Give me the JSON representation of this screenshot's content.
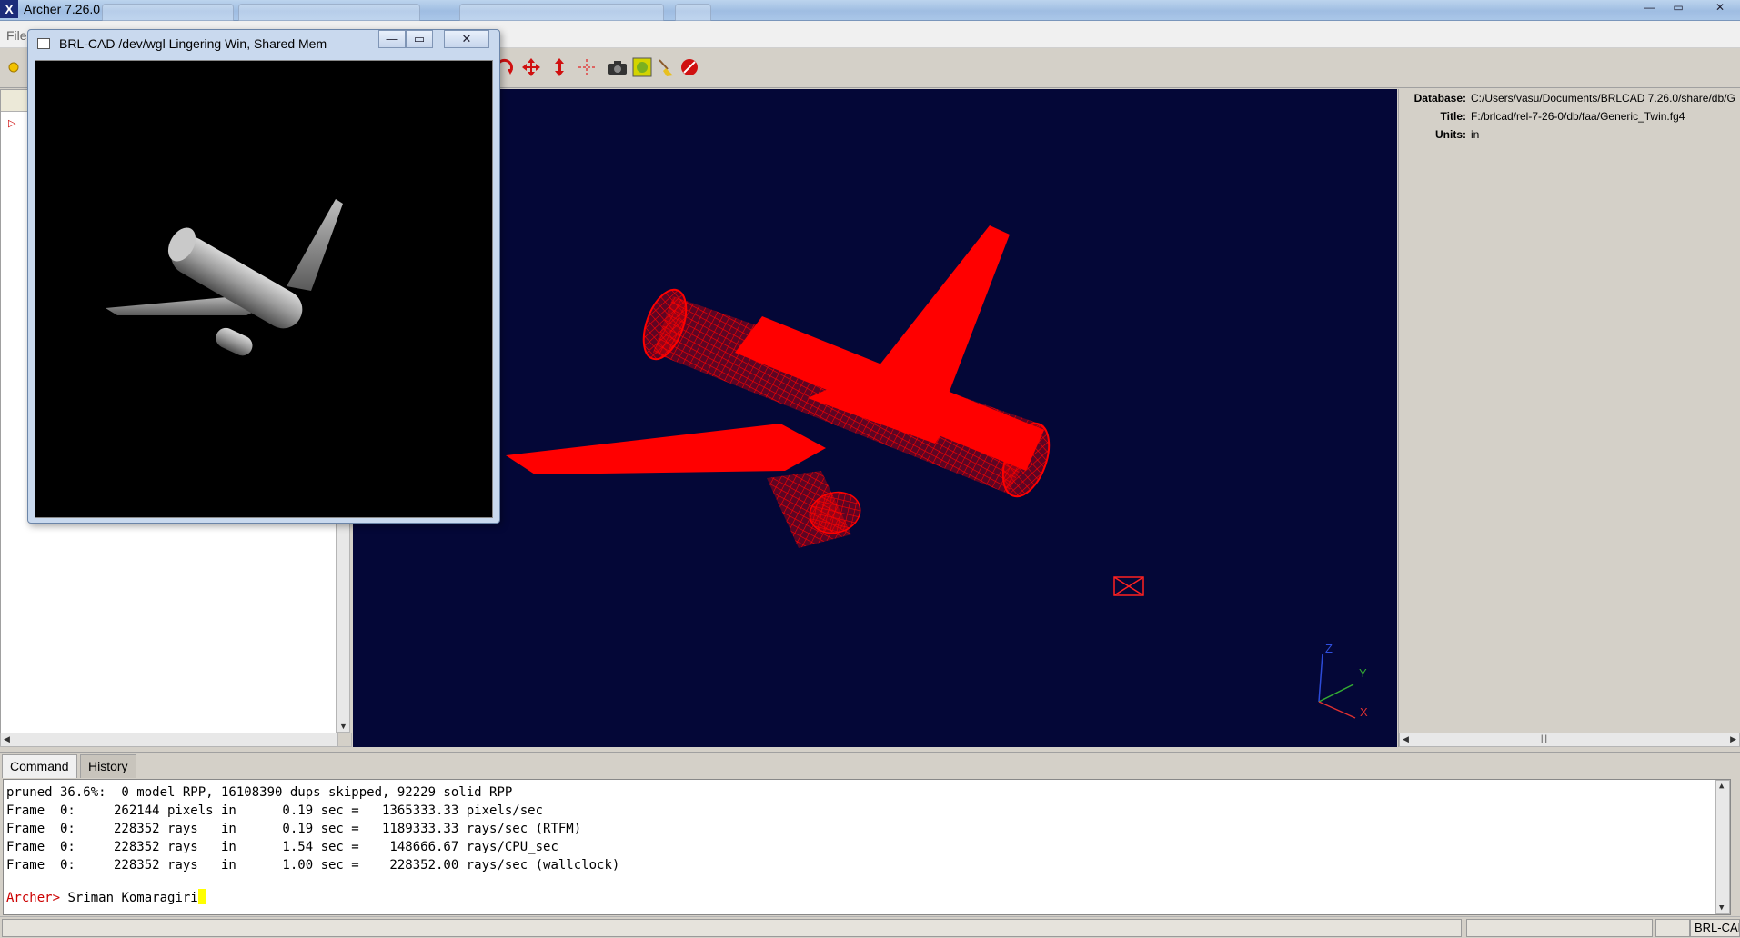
{
  "window": {
    "title": "Archer 7.26.0",
    "icon_glyph": "X",
    "controls": {
      "minimize": "—",
      "maximize": "▭",
      "close": "✕"
    }
  },
  "menu": {
    "file": "File"
  },
  "properties": [
    {
      "key": "Database:",
      "value": "C:/Users/vasu/Documents/BRLCAD 7.26.0/share/db/G"
    },
    {
      "key": "Title:",
      "value": "F:/brlcad/rel-7-26-0/db/faa/Generic_Twin.fg4"
    },
    {
      "key": "Units:",
      "value": "in"
    }
  ],
  "axes": {
    "x": "X",
    "y": "Y",
    "z": "Z"
  },
  "command_tabs": {
    "command": "Command",
    "history": "History"
  },
  "console": {
    "lines": [
      "pruned 36.6%:  0 model RPP, 16108390 dups skipped, 92229 solid RPP",
      "Frame  0:     262144 pixels in      0.19 sec =   1365333.33 pixels/sec",
      "Frame  0:     228352 rays   in      0.19 sec =   1189333.33 rays/sec (RTFM)",
      "Frame  0:     228352 rays   in      1.54 sec =    148666.67 rays/CPU_sec",
      "Frame  0:     228352 rays   in      1.00 sec =    228352.00 rays/sec (wallclock)"
    ],
    "prompt": "Archer>",
    "input_value": " Sriman Komaragiri"
  },
  "statusbar": {
    "app_label": "BRL-CAD"
  },
  "raytrace_window": {
    "title": "BRL-CAD /dev/wgl Lingering Win, Shared Mem",
    "controls": {
      "minimize": "—",
      "maximize": "▭",
      "close": "✕"
    }
  },
  "colors": {
    "viewport_bg": "#040737",
    "wireframe": "#ff0000",
    "prompt": "#cc0000",
    "cursor": "#ffff00"
  },
  "icons": [
    "rotate-icon",
    "pan-icon",
    "scale-icon",
    "center-icon",
    "camera-icon",
    "raytrace-icon",
    "clear-icon",
    "stop-icon"
  ]
}
